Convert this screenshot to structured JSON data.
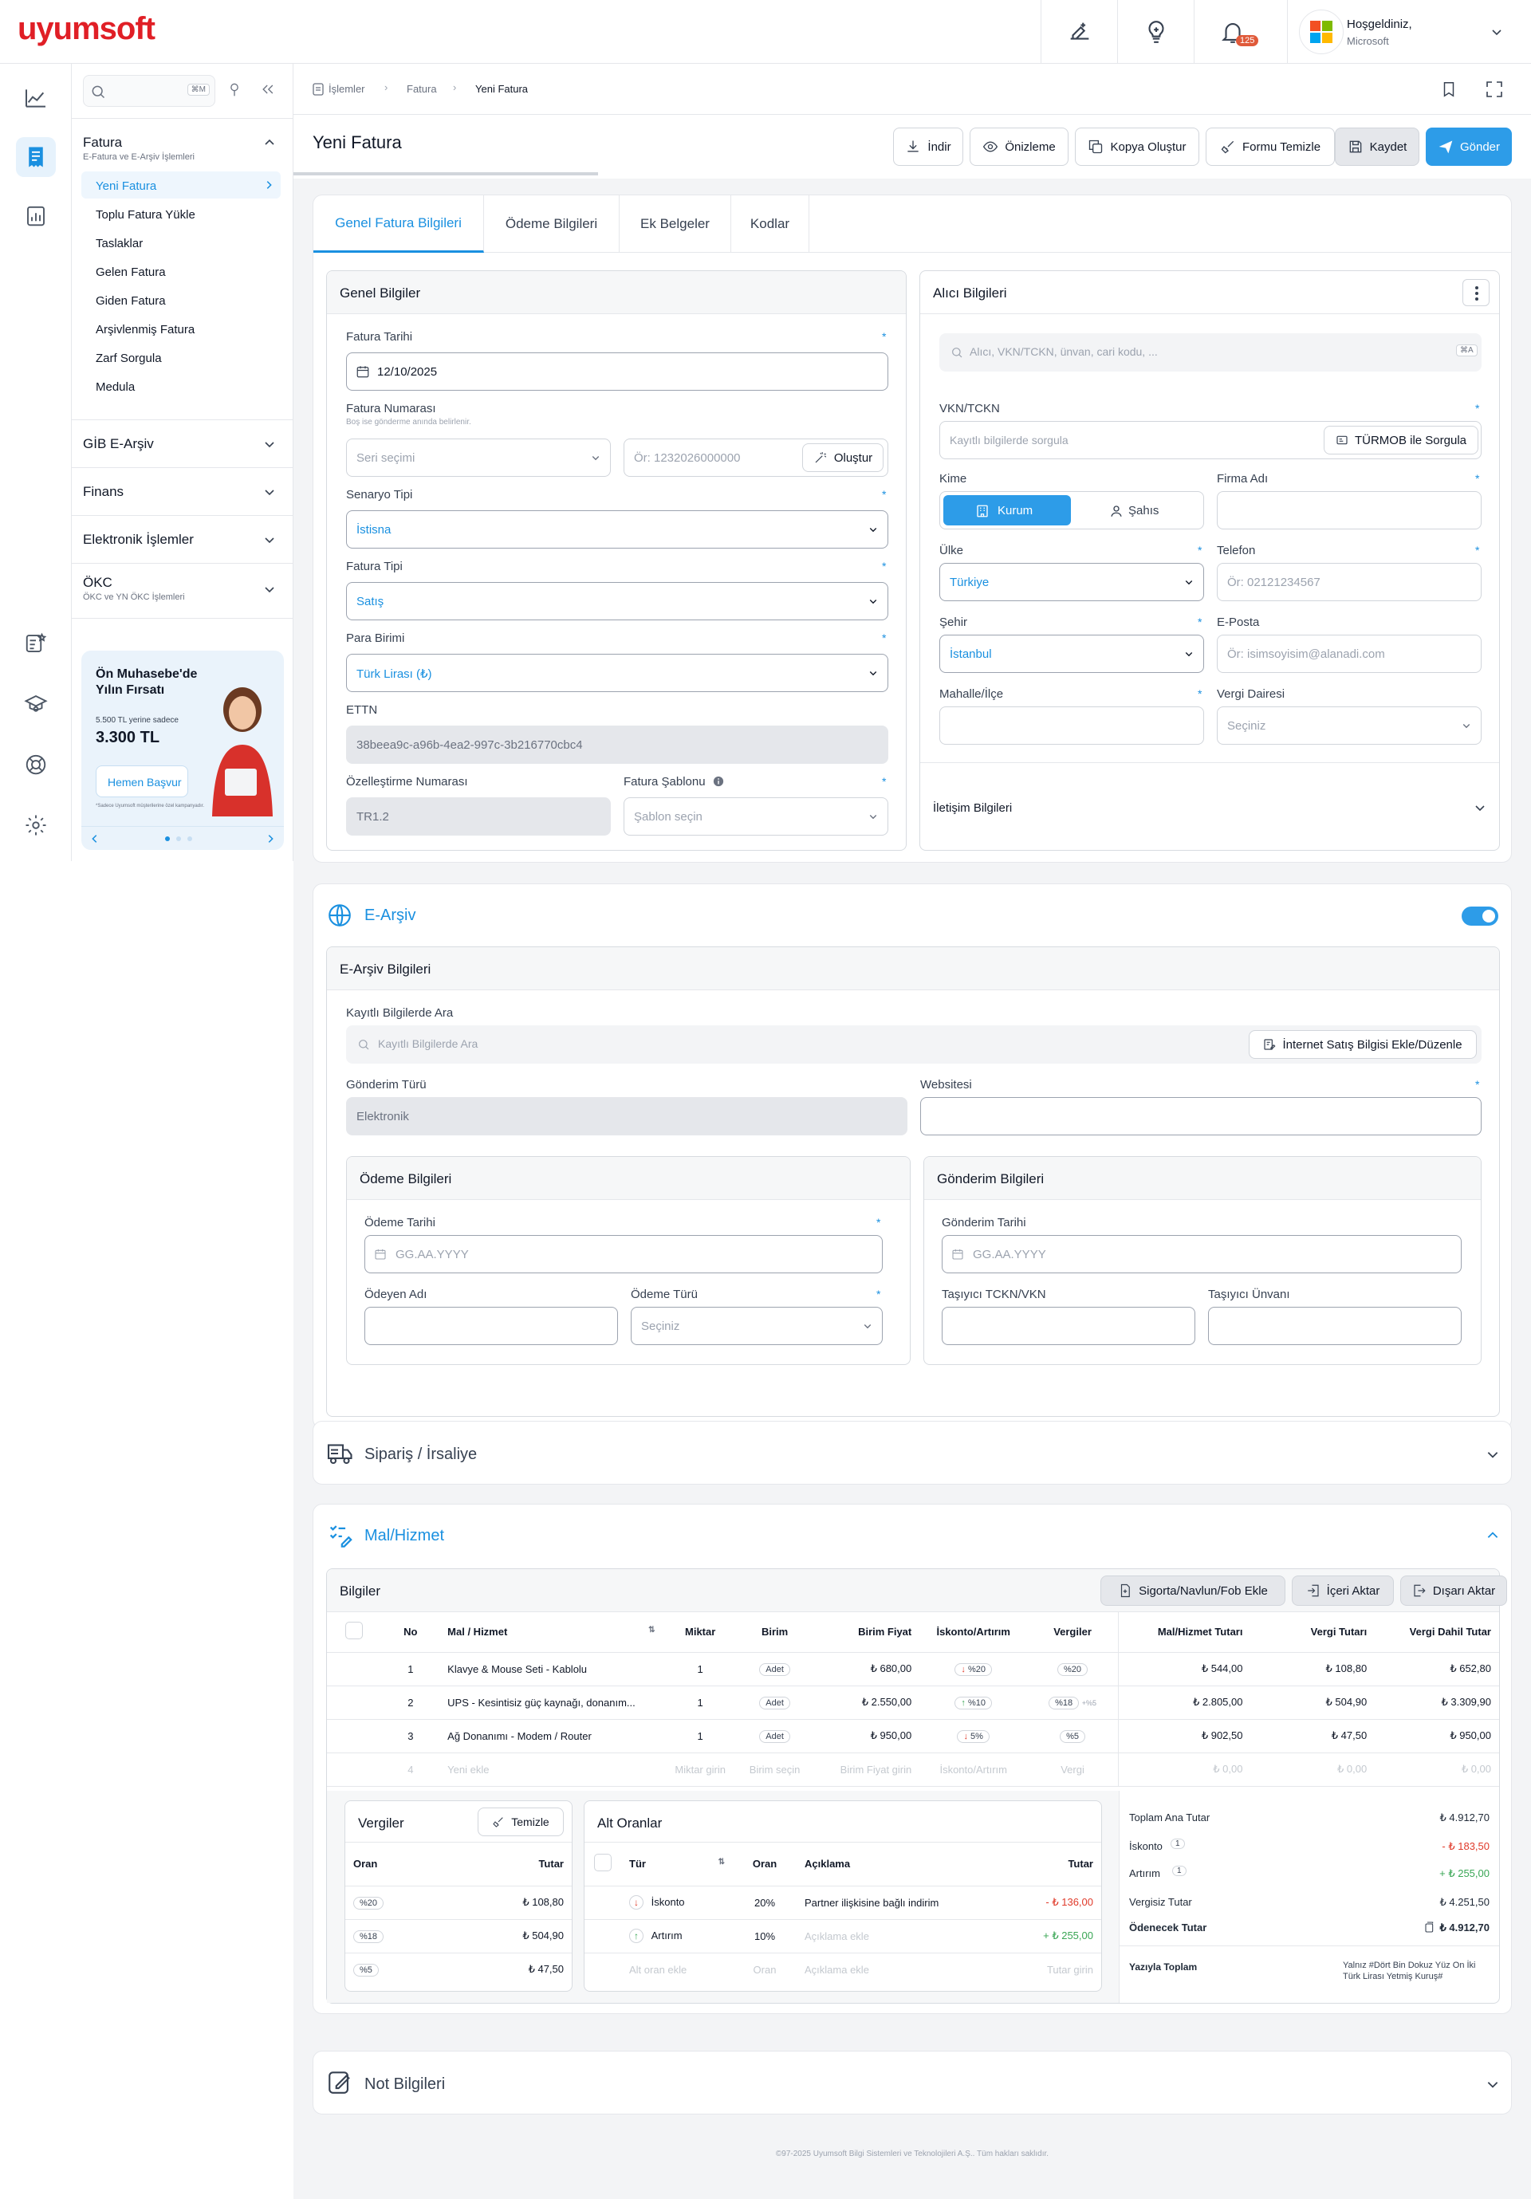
{
  "brand": {
    "logo": "uyumsoft"
  },
  "topbar": {
    "notif_count": "125",
    "greeting": "Hoşgeldiniz,",
    "company": "Microsoft"
  },
  "menu": {
    "search_kbd": "⌘M",
    "fatura": {
      "title": "Fatura",
      "subtitle": "E-Fatura ve E-Arşiv İşlemleri",
      "items": [
        "Yeni Fatura",
        "Toplu Fatura Yükle",
        "Taslaklar",
        "Gelen Fatura",
        "Giden Fatura",
        "Arşivlenmiş Fatura",
        "Zarf Sorgula",
        "Medula"
      ]
    },
    "sections": [
      "GİB E-Arşiv",
      "Finans",
      "Elektronik İşlemler"
    ],
    "okc": {
      "title": "ÖKC",
      "subtitle": "ÖKC ve YN ÖKC İşlemleri"
    },
    "promo": {
      "title": "Ön Muhasebe'de Yılın Fırsatı",
      "old_price": "5.500 TL yerine sadece",
      "price": "3.300 TL",
      "cta": "Hemen Başvur",
      "note": "*Sadece Uyumsoft müşterilerine özel kampanyadır."
    }
  },
  "breadcrumb": [
    "İşlemler",
    "Fatura",
    "Yeni Fatura"
  ],
  "page": {
    "title": "Yeni Fatura"
  },
  "toolbar": {
    "download": "İndir",
    "preview": "Önizleme",
    "copy": "Kopya Oluştur",
    "clear": "Formu Temizle",
    "save": "Kaydet",
    "send": "Gönder"
  },
  "tabs": [
    "Genel Fatura Bilgileri",
    "Ödeme Bilgileri",
    "Ek Belgeler",
    "Kodlar"
  ],
  "genel": {
    "title": "Genel Bilgiler",
    "fatura_tarihi_label": "Fatura Tarihi",
    "fatura_tarihi": "12/10/2025",
    "fatura_no_label": "Fatura Numarası",
    "fatura_no_hint": "Boş ise gönderme anında belirlenir.",
    "seri_placeholder": "Seri seçimi",
    "no_placeholder": "Ör: 1232026000000",
    "olustur": "Oluştur",
    "senaryo_label": "Senaryo Tipi",
    "senaryo": "İstisna",
    "tip_label": "Fatura Tipi",
    "tip": "Satış",
    "para_label": "Para Birimi",
    "para": "Türk Lirası  (₺)",
    "ettn_label": "ETTN",
    "ettn": "38beea9c-a96b-4ea2-997c-3b216770cbc4",
    "ozel_label": "Özelleştirme Numarası",
    "ozel": "TR1.2",
    "sablon_label": "Fatura Şablonu",
    "sablon_placeholder": "Şablon seçin"
  },
  "alici": {
    "title": "Alıcı Bilgileri",
    "search_placeholder": "Alıcı, VKN/TCKN, ünvan, cari kodu, ...",
    "search_kbd": "⌘A",
    "vkn_label": "VKN/TCKN",
    "vkn_placeholder": "Kayıtlı bilgilerde sorgula",
    "turmob": "TÜRMOB ile Sorgula",
    "kime_label": "Kime",
    "kurum": "Kurum",
    "sahis": "Şahıs",
    "firma_label": "Firma Adı",
    "ulke_label": "Ülke",
    "ulke": "Türkiye",
    "telefon_label": "Telefon",
    "telefon_placeholder": "Ör: 02121234567",
    "sehir_label": "Şehir",
    "sehir": "İstanbul",
    "eposta_label": "E-Posta",
    "eposta_placeholder": "Ör: isimsoyisim@alanadi.com",
    "mahalle_label": "Mahalle/İlçe",
    "vergi_label": "Vergi Dairesi",
    "vergi_placeholder": "Seçiniz",
    "iletisim": "İletişim Bilgileri"
  },
  "earsiv": {
    "title": "E-Arşiv",
    "panel": "E-Arşiv Bilgileri",
    "kayitli_label": "Kayıtlı Bilgilerde Ara",
    "kayitli_placeholder": "Kayıtlı Bilgilerde Ara",
    "internet_btn": "İnternet Satış Bilgisi Ekle/Düzenle",
    "gonderim_turu_label": "Gönderim Türü",
    "gonderim_turu": "Elektronik",
    "website_label": "Websitesi",
    "odeme": {
      "title": "Ödeme Bilgileri",
      "tarih_label": "Ödeme Tarihi",
      "tarih_placeholder": "GG.AA.YYYY",
      "odeyen_label": "Ödeyen Adı",
      "tur_label": "Ödeme Türü",
      "tur_placeholder": "Seçiniz"
    },
    "gonderim": {
      "title": "Gönderim Bilgileri",
      "tarih_label": "Gönderim Tarihi",
      "tarih_placeholder": "GG.AA.YYYY",
      "tasiyici_vkn_label": "Taşıyıcı TCKN/VKN",
      "tasiyici_unvan_label": "Taşıyıcı Ünvanı"
    }
  },
  "siparis": {
    "title": "Sipariş / İrsaliye"
  },
  "mal": {
    "title": "Mal/Hizmet",
    "panel": "Bilgiler",
    "buttons": {
      "sigorta": "Sigorta/Navlun/Fob Ekle",
      "iceri": "İçeri Aktar",
      "disari": "Dışarı Aktar"
    },
    "columns": [
      "No",
      "Mal / Hizmet",
      "Miktar",
      "Birim",
      "Birim Fiyat",
      "İskonto/Artırım",
      "Vergiler",
      "Mal/Hizmet Tutarı",
      "Vergi Tutarı",
      "Vergi Dahil Tutar"
    ],
    "rows": [
      {
        "no": "1",
        "name": "Klavye & Mouse Seti - Kablolu",
        "qty": "1",
        "unit": "Adet",
        "price": "₺ 680,00",
        "disc": "%20",
        "tax": "%20",
        "extra": "",
        "total": "₺ 544,00",
        "vat": "₺ 108,80",
        "gross": "₺ 652,80"
      },
      {
        "no": "2",
        "name": "UPS - Kesintisiz güç kaynağı, donanım...",
        "qty": "1",
        "unit": "Adet",
        "price": "₺ 2.550,00",
        "disc": "%10",
        "tax": "%18",
        "extra": "+%5",
        "total": "₺ 2.805,00",
        "vat": "₺ 504,90",
        "gross": "₺ 3.309,90"
      },
      {
        "no": "3",
        "name": "Ağ Donanımı - Modem / Router",
        "qty": "1",
        "unit": "Adet",
        "price": "₺ 950,00",
        "disc": "5%",
        "tax": "%5",
        "extra": "",
        "total": "₺ 902,50",
        "vat": "₺ 47,50",
        "gross": "₺ 950,00"
      }
    ],
    "new_row": {
      "no": "4",
      "name": "Yeni ekle",
      "qty": "Miktar girin",
      "unit": "Birim seçin",
      "price": "Birim Fiyat girin",
      "disc": "İskonto/Artırım",
      "tax": "Vergi",
      "total": "₺ 0,00",
      "vat": "₺ 0,00",
      "gross": "₺ 0,00"
    },
    "vergiler": {
      "title": "Vergiler",
      "clear": "Temizle",
      "col_oran": "Oran",
      "col_tutar": "Tutar",
      "rows": [
        {
          "oran": "%20",
          "tutar": "₺ 108,80"
        },
        {
          "oran": "%18",
          "tutar": "₺ 504,90"
        },
        {
          "oran": "%5",
          "tutar": "₺ 47,50"
        }
      ]
    },
    "alt": {
      "title": "Alt Oranlar",
      "cols": [
        "Tür",
        "Oran",
        "Açıklama",
        "Tutar"
      ],
      "rows": [
        {
          "tur": "İskonto",
          "oran": "20%",
          "aciklama": "Partner ilişkisine bağlı indirim",
          "tutar": "- ₺ 136,00"
        },
        {
          "tur": "Artırım",
          "oran": "10%",
          "aciklama": "Açıklama ekle",
          "tutar": "+ ₺ 255,00"
        }
      ],
      "new": {
        "tur": "Alt oran ekle",
        "oran": "Oran",
        "aciklama": "Açıklama ekle",
        "tutar": "Tutar girin"
      }
    },
    "totals": {
      "ana_label": "Toplam Ana Tutar",
      "ana": "₺ 4.912,70",
      "iskonto_label": "İskonto",
      "iskonto_count": "1",
      "iskonto": "- ₺ 183,50",
      "artirim_label": "Artırım",
      "artirim_count": "1",
      "artirim": "+ ₺ 255,00",
      "vergisiz_label": "Vergisiz Tutar",
      "vergisiz": "₺ 4.251,50",
      "odenecek_label": "Ödenecek Tutar",
      "odenecek": "₺ 4.912,70",
      "yazi_label": "Yazıyla Toplam",
      "yazi": "Yalnız #Dört Bin Dokuz Yüz On İki Türk Lirası Yetmiş Kuruş#"
    }
  },
  "not": {
    "title": "Not Bilgileri"
  },
  "footer": "©97-2025 Uyumsoft Bilgi Sistemleri ve Teknolojileri A.Ş.. Tüm hakları saklıdır.",
  "colors": {
    "accent": "#1a90e0",
    "brand": "#e01f26"
  }
}
